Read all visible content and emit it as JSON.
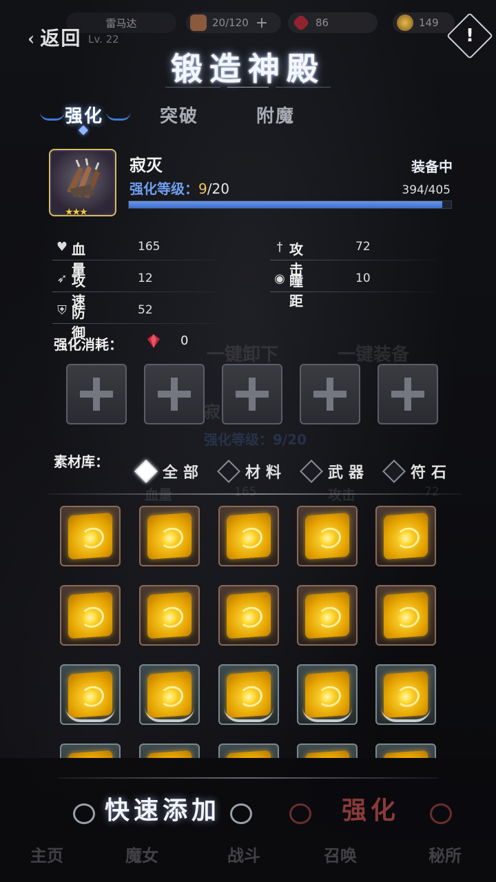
{
  "status": {
    "player_name": "雷马达",
    "player_level": "Lv. 22",
    "stamina": "20/120",
    "gems": "86",
    "coins": "149"
  },
  "header": {
    "back_label": "返回",
    "title": "锻造神殿",
    "alert_symbol": "!"
  },
  "tabs": [
    {
      "label": "强化",
      "active": true
    },
    {
      "label": "突破",
      "active": false
    },
    {
      "label": "附魔",
      "active": false
    }
  ],
  "item": {
    "name": "寂灭",
    "level_label": "强化等级：",
    "level_current": "9",
    "level_max": "/20",
    "stars": "★★★",
    "equipped_label": "装备中",
    "exp": "394/405",
    "exp_progress": 0.973
  },
  "stats": [
    {
      "icon": "heart-icon",
      "label": "血量",
      "value": "165"
    },
    {
      "icon": "sword-icon",
      "label": "攻击",
      "value": "72"
    },
    {
      "icon": "feather-icon",
      "label": "攻速",
      "value": "12"
    },
    {
      "icon": "eye-icon",
      "label": "瞳距",
      "value": "10"
    },
    {
      "icon": "shield-icon",
      "label": "防御",
      "value": "52"
    }
  ],
  "cost": {
    "label": "强化消耗：",
    "value": "0"
  },
  "library": {
    "label": "素材库：",
    "filters": [
      {
        "label": "全部",
        "active": true
      },
      {
        "label": "材料",
        "active": false
      },
      {
        "label": "武器",
        "active": false
      },
      {
        "label": "符石",
        "active": false
      }
    ]
  },
  "actions": {
    "quick_add": "快速添加",
    "enhance": "强化"
  },
  "bottom_nav": [
    "主页",
    "魔女",
    "战斗",
    "召唤",
    "秘所"
  ],
  "background_ghost": {
    "quick_unequip": "一键卸下",
    "quick_equip": "一键装备",
    "ghost_name": "寂",
    "ghost_level": "强化等级：9/20",
    "ghost_hp": "血量",
    "ghost_hp_val": "165",
    "ghost_atk": "攻击",
    "ghost_atk_val": "72"
  },
  "colors": {
    "accent_blue": "#3e6fcf",
    "gold": "#f2c25b",
    "enhance_red": "#8b3a3a"
  }
}
